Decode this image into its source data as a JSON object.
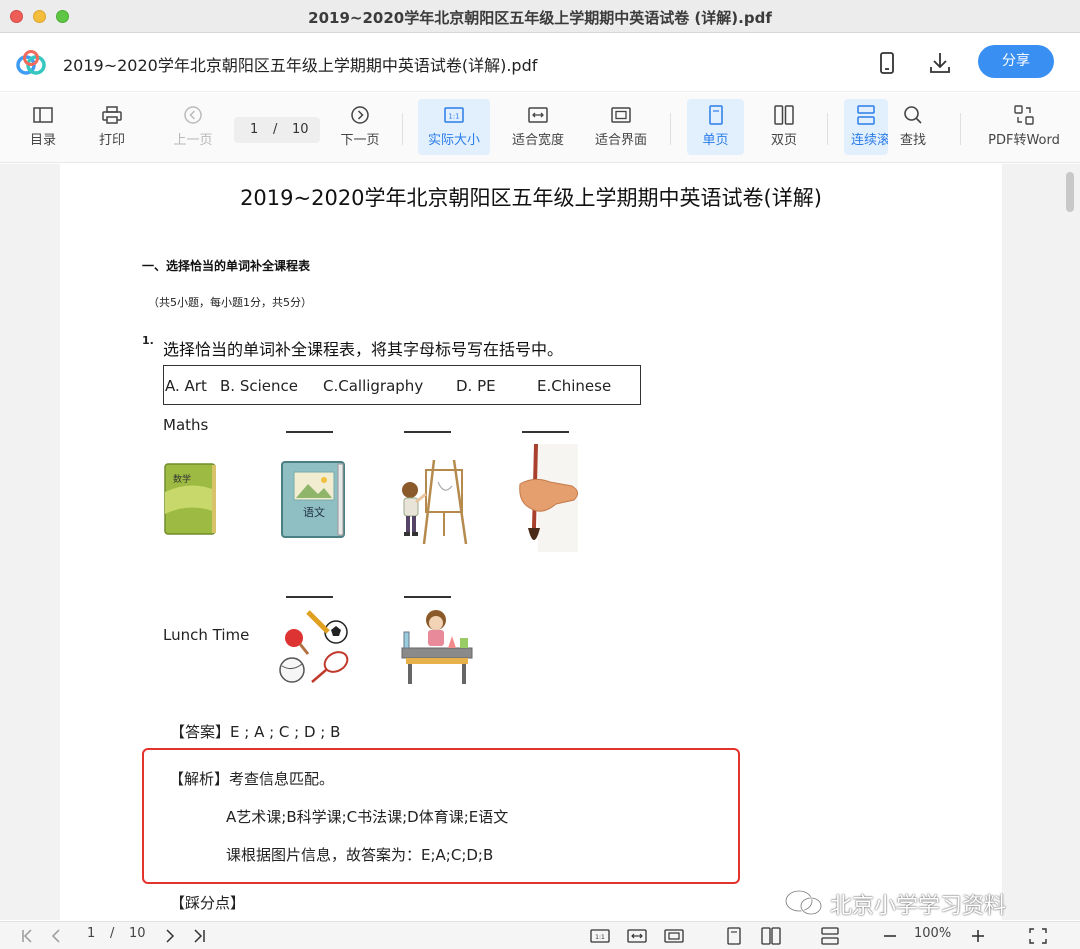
{
  "window": {
    "title": "2019~2020学年北京朝阳区五年级上学期期中英语试卷 (详解).pdf"
  },
  "header": {
    "doc_title": "2019~2020学年北京朝阳区五年级上学期期中英语试卷(详解).pdf",
    "share_label": "分享"
  },
  "toolbar": {
    "toc": "目录",
    "print": "打印",
    "prev": "上一页",
    "page_current": "1",
    "page_sep": "/",
    "page_total": "10",
    "next": "下一页",
    "actual_size": "实际大小",
    "fit_width": "适合宽度",
    "fit_page": "适合界面",
    "single": "单页",
    "double": "双页",
    "continuous": "连续滚",
    "find": "查找",
    "pdf2word": "PDF转Word"
  },
  "doc": {
    "title": "2019~2020学年北京朝阳区五年级上学期期中英语试卷(详解)",
    "section": "一、选择恰当的单词补全课程表",
    "note": "（共5小题，每小题1分，共5分）",
    "q_num": "1.",
    "q_text": "选择恰当的单词补全课程表，将其字母标号写在括号中。",
    "options": [
      "A. Art",
      "B. Science",
      "C.Calligraphy",
      "D. PE",
      "E.Chinese"
    ],
    "row1_label": "Maths",
    "row2_label": "Lunch Time",
    "book_math_label": "数学",
    "book_chinese_label": "语文",
    "answer": "【答案】E ; A ; C ; D ; B",
    "explain_title": "【解析】考查信息匹配。",
    "explain_line1": "A艺术课;B科学课;C书法课;D体育课;E语文",
    "explain_line2": "课根据图片信息，故答案为：E;A;C;D;B",
    "points_title": "【踩分点】"
  },
  "watermark": "北京小学学习资料",
  "bottombar": {
    "page_current": "1",
    "page_sep": "/",
    "page_total": "10",
    "zoom": "100%"
  },
  "colors": {
    "accent": "#3a8ff2",
    "highlight_box": "#e3342b",
    "active_bg": "#e2effd"
  }
}
